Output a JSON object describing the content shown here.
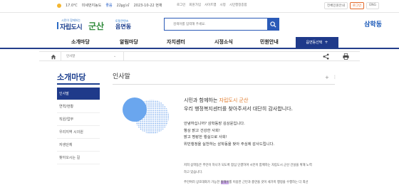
{
  "utility": {
    "weather_temp": "17.0℃",
    "weather_place": "미세먼지농도",
    "air_label": "좋음",
    "air_value": "22㎍/㎥",
    "date": "2023-10-22 현재",
    "links": [
      "로그인",
      "회원가입",
      "사이트맵",
      "시청",
      "시민행정종합"
    ],
    "btn_all_news": "전체민원안내",
    "btn_lang": "로그인",
    "btn_english": "ENG"
  },
  "logo": {
    "slogan": "시민이 함께하는",
    "city": "자립도시",
    "gunsan": "군산",
    "smart": "토탈콘텐츠",
    "town": "음면동"
  },
  "search": {
    "placeholder": "검색어를 입력해 주세요."
  },
  "town_name": "삼학동",
  "nav": {
    "items": [
      "소개마당",
      "알림마당",
      "자치센터",
      "시정소식",
      "민원안내"
    ],
    "town_select": "읍면동선택"
  },
  "breadcrumb": {
    "label": "인사말"
  },
  "sidebar": {
    "title": "소개마당",
    "items": [
      "인사말",
      "연혁/현황",
      "직원/업무",
      "우리지역 시의원",
      "자생단체",
      "찾아오시는 길"
    ]
  },
  "content": {
    "title": "인사말",
    "greeting_line1_a": "시민과 함께하는 ",
    "greeting_line1_b": "자립도시 군산",
    "greeting_line2": "우리 행정복지센터를 찾아주셔서 대단히 감사합니다.",
    "message": [
      "안녕하십니까? 삼학동장 김상윤입니다.",
      "항상 밝고 건강한 사회!",
      "밝고 명랑한 행실으로 사회!",
      "위민행정을 실천하는 삼학동을 찾아 주심에 감사드립니다."
    ],
    "body_line1": "저희 삼학동은 주민이 하나가 되도록 합심 단결하여 시민이 함께하는 자립도시 군산 건설을 위해 노력",
    "body_line2": "하고 있습니다.",
    "body_line3_a": "주민여러 상호대화가 가능한 ",
    "body_line3_mark": "올해이",
    "body_line3_b": "를 이용한 근민과 총연을 갖이 세가미 행정을 수행하는 더 최선"
  },
  "colors": {
    "primary": "#1f3a8a",
    "accent_orange": "#e07a2a",
    "link_blue": "#1a59b8"
  }
}
